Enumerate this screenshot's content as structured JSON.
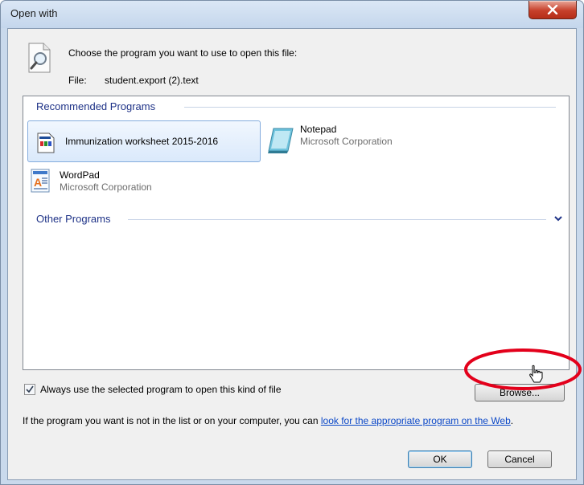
{
  "window": {
    "title": "Open with"
  },
  "header": {
    "prompt": "Choose the program you want to use to open this file:",
    "file_label": "File:",
    "file_name": "student.export (2).text"
  },
  "sections": {
    "recommended": "Recommended Programs",
    "other": "Other Programs"
  },
  "programs": [
    {
      "name": "Immunization worksheet 2015-2016",
      "company": "",
      "selected": true,
      "icon": "worksheet-icon"
    },
    {
      "name": "Notepad",
      "company": "Microsoft Corporation",
      "selected": false,
      "icon": "notepad-icon"
    },
    {
      "name": "WordPad",
      "company": "Microsoft Corporation",
      "selected": false,
      "icon": "wordpad-icon"
    }
  ],
  "always_use": {
    "label": "Always use the selected program to open this kind of file",
    "checked": true
  },
  "info": {
    "text": "If the program you want is not in the list or on your computer, you can ",
    "link": "look for the appropriate program on the Web",
    "end": "."
  },
  "buttons": {
    "browse": "Browse...",
    "ok": "OK",
    "cancel": "Cancel"
  },
  "colors": {
    "section_text": "#1e3287",
    "link": "#0a47c7",
    "annotation": "#e3001b",
    "close": "#c7402b"
  }
}
